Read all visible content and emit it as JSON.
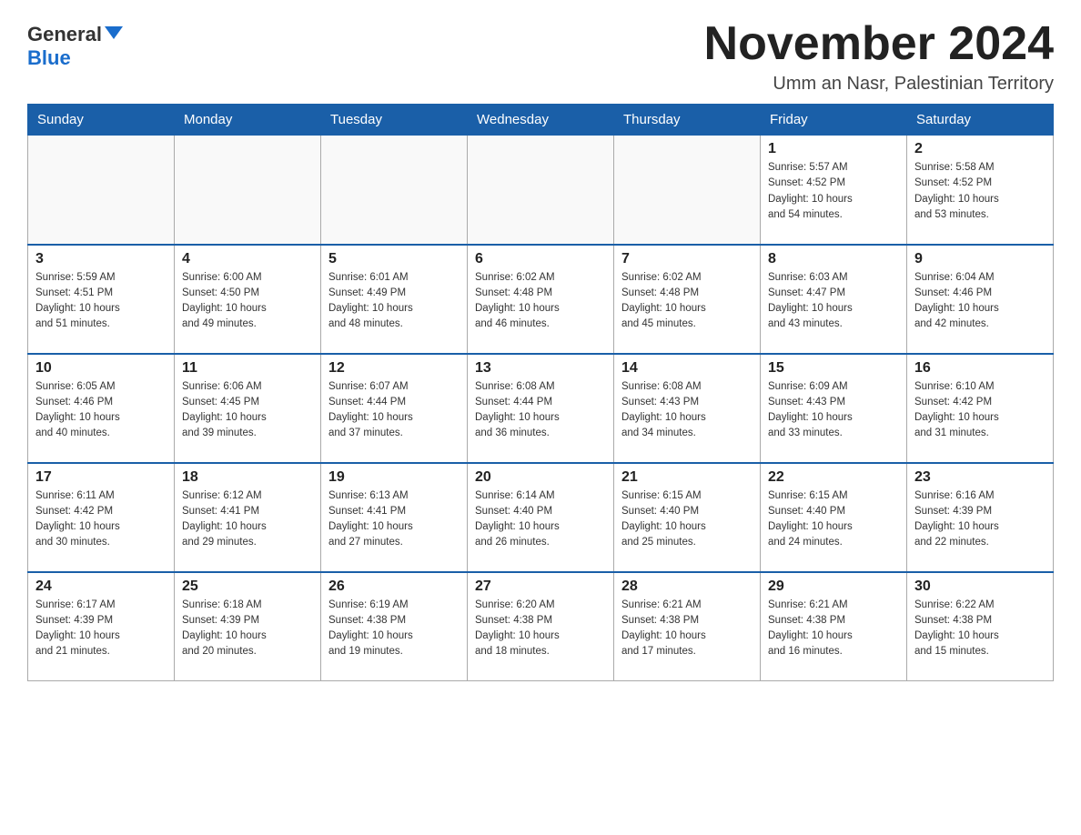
{
  "header": {
    "logo_general": "General",
    "logo_blue": "Blue",
    "month_title": "November 2024",
    "location": "Umm an Nasr, Palestinian Territory"
  },
  "weekdays": [
    "Sunday",
    "Monday",
    "Tuesday",
    "Wednesday",
    "Thursday",
    "Friday",
    "Saturday"
  ],
  "weeks": [
    [
      {
        "day": "",
        "info": ""
      },
      {
        "day": "",
        "info": ""
      },
      {
        "day": "",
        "info": ""
      },
      {
        "day": "",
        "info": ""
      },
      {
        "day": "",
        "info": ""
      },
      {
        "day": "1",
        "info": "Sunrise: 5:57 AM\nSunset: 4:52 PM\nDaylight: 10 hours\nand 54 minutes."
      },
      {
        "day": "2",
        "info": "Sunrise: 5:58 AM\nSunset: 4:52 PM\nDaylight: 10 hours\nand 53 minutes."
      }
    ],
    [
      {
        "day": "3",
        "info": "Sunrise: 5:59 AM\nSunset: 4:51 PM\nDaylight: 10 hours\nand 51 minutes."
      },
      {
        "day": "4",
        "info": "Sunrise: 6:00 AM\nSunset: 4:50 PM\nDaylight: 10 hours\nand 49 minutes."
      },
      {
        "day": "5",
        "info": "Sunrise: 6:01 AM\nSunset: 4:49 PM\nDaylight: 10 hours\nand 48 minutes."
      },
      {
        "day": "6",
        "info": "Sunrise: 6:02 AM\nSunset: 4:48 PM\nDaylight: 10 hours\nand 46 minutes."
      },
      {
        "day": "7",
        "info": "Sunrise: 6:02 AM\nSunset: 4:48 PM\nDaylight: 10 hours\nand 45 minutes."
      },
      {
        "day": "8",
        "info": "Sunrise: 6:03 AM\nSunset: 4:47 PM\nDaylight: 10 hours\nand 43 minutes."
      },
      {
        "day": "9",
        "info": "Sunrise: 6:04 AM\nSunset: 4:46 PM\nDaylight: 10 hours\nand 42 minutes."
      }
    ],
    [
      {
        "day": "10",
        "info": "Sunrise: 6:05 AM\nSunset: 4:46 PM\nDaylight: 10 hours\nand 40 minutes."
      },
      {
        "day": "11",
        "info": "Sunrise: 6:06 AM\nSunset: 4:45 PM\nDaylight: 10 hours\nand 39 minutes."
      },
      {
        "day": "12",
        "info": "Sunrise: 6:07 AM\nSunset: 4:44 PM\nDaylight: 10 hours\nand 37 minutes."
      },
      {
        "day": "13",
        "info": "Sunrise: 6:08 AM\nSunset: 4:44 PM\nDaylight: 10 hours\nand 36 minutes."
      },
      {
        "day": "14",
        "info": "Sunrise: 6:08 AM\nSunset: 4:43 PM\nDaylight: 10 hours\nand 34 minutes."
      },
      {
        "day": "15",
        "info": "Sunrise: 6:09 AM\nSunset: 4:43 PM\nDaylight: 10 hours\nand 33 minutes."
      },
      {
        "day": "16",
        "info": "Sunrise: 6:10 AM\nSunset: 4:42 PM\nDaylight: 10 hours\nand 31 minutes."
      }
    ],
    [
      {
        "day": "17",
        "info": "Sunrise: 6:11 AM\nSunset: 4:42 PM\nDaylight: 10 hours\nand 30 minutes."
      },
      {
        "day": "18",
        "info": "Sunrise: 6:12 AM\nSunset: 4:41 PM\nDaylight: 10 hours\nand 29 minutes."
      },
      {
        "day": "19",
        "info": "Sunrise: 6:13 AM\nSunset: 4:41 PM\nDaylight: 10 hours\nand 27 minutes."
      },
      {
        "day": "20",
        "info": "Sunrise: 6:14 AM\nSunset: 4:40 PM\nDaylight: 10 hours\nand 26 minutes."
      },
      {
        "day": "21",
        "info": "Sunrise: 6:15 AM\nSunset: 4:40 PM\nDaylight: 10 hours\nand 25 minutes."
      },
      {
        "day": "22",
        "info": "Sunrise: 6:15 AM\nSunset: 4:40 PM\nDaylight: 10 hours\nand 24 minutes."
      },
      {
        "day": "23",
        "info": "Sunrise: 6:16 AM\nSunset: 4:39 PM\nDaylight: 10 hours\nand 22 minutes."
      }
    ],
    [
      {
        "day": "24",
        "info": "Sunrise: 6:17 AM\nSunset: 4:39 PM\nDaylight: 10 hours\nand 21 minutes."
      },
      {
        "day": "25",
        "info": "Sunrise: 6:18 AM\nSunset: 4:39 PM\nDaylight: 10 hours\nand 20 minutes."
      },
      {
        "day": "26",
        "info": "Sunrise: 6:19 AM\nSunset: 4:38 PM\nDaylight: 10 hours\nand 19 minutes."
      },
      {
        "day": "27",
        "info": "Sunrise: 6:20 AM\nSunset: 4:38 PM\nDaylight: 10 hours\nand 18 minutes."
      },
      {
        "day": "28",
        "info": "Sunrise: 6:21 AM\nSunset: 4:38 PM\nDaylight: 10 hours\nand 17 minutes."
      },
      {
        "day": "29",
        "info": "Sunrise: 6:21 AM\nSunset: 4:38 PM\nDaylight: 10 hours\nand 16 minutes."
      },
      {
        "day": "30",
        "info": "Sunrise: 6:22 AM\nSunset: 4:38 PM\nDaylight: 10 hours\nand 15 minutes."
      }
    ]
  ]
}
